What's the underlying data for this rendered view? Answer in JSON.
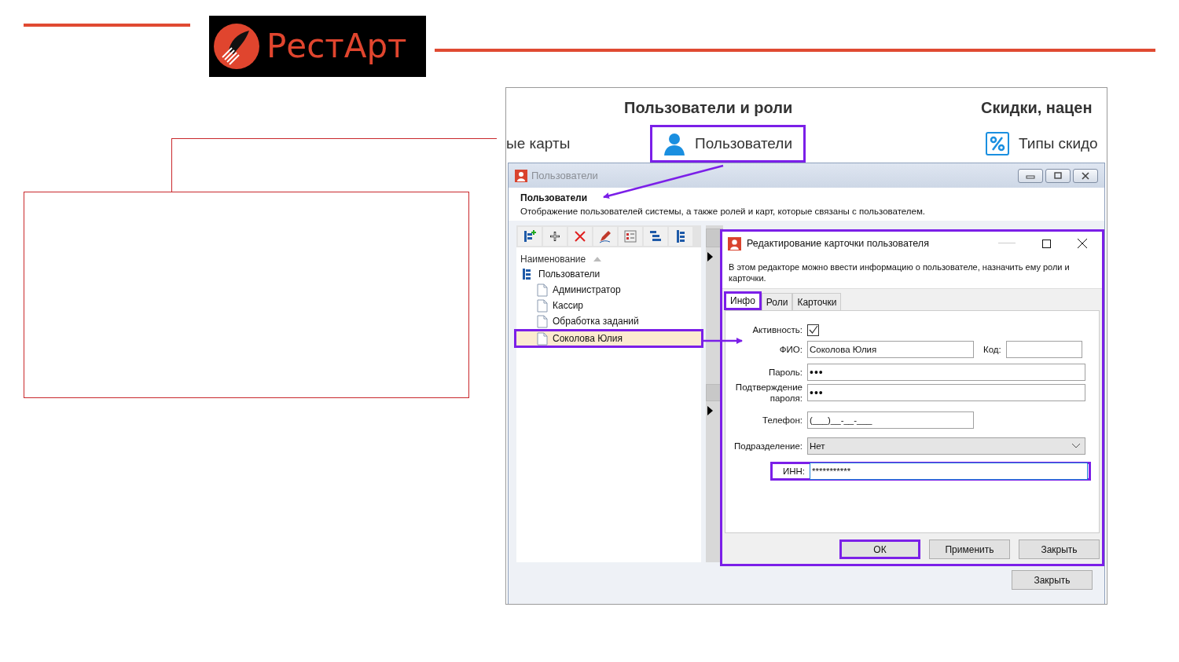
{
  "slide": {
    "logo": {
      "text": "РестАрт"
    }
  },
  "screenshot": {
    "ribbon": {
      "groups": [
        {
          "title": "Пользователи и роли"
        },
        {
          "title": "Скидки, нацен"
        }
      ],
      "items": [
        {
          "label": "ые карты",
          "kind": "text",
          "highlighted": false
        },
        {
          "label": "Пользователи",
          "kind": "user",
          "highlighted": true
        },
        {
          "label": "Типы скидо",
          "kind": "percent",
          "highlighted": false
        }
      ]
    },
    "users_window": {
      "title": "Пользователи",
      "heading": "Пользователи",
      "description": "Отображение пользователей системы, а также ролей и карт, которые связаны с пользователем.",
      "tree": {
        "column": "Наименование",
        "root": {
          "label": "Пользователи",
          "children": [
            {
              "label": "Администратор",
              "selected": false,
              "highlighted": false
            },
            {
              "label": "Кассир",
              "selected": false,
              "highlighted": false
            },
            {
              "label": "Обработка заданий",
              "selected": false,
              "highlighted": false
            },
            {
              "label": "Соколова Юлия",
              "selected": true,
              "highlighted": true
            }
          ]
        }
      },
      "close_button": "Закрыть"
    },
    "editor": {
      "title": "Редактирование карточки пользователя",
      "highlighted": true,
      "description": "В этом редакторе можно ввести информацию о пользователе, назначить ему роли и карточки.",
      "tabs": [
        {
          "label": "Инфо",
          "selected": true,
          "highlighted": true
        },
        {
          "label": "Роли",
          "selected": false,
          "highlighted": false
        },
        {
          "label": "Карточки",
          "selected": false,
          "highlighted": false
        }
      ],
      "fields": [
        {
          "kind": "checkbox",
          "label": "Активность:",
          "checked": true,
          "highlighted": false
        },
        {
          "kind": "text",
          "label": "ФИО:",
          "value": "Соколова Юлия",
          "extra": {
            "label": "Код:"
          },
          "highlighted": false
        },
        {
          "kind": "password",
          "label": "Пароль:",
          "value": "•••",
          "highlighted": false
        },
        {
          "kind": "password",
          "label": "Подтверждение пароля:",
          "value": "•••",
          "highlighted": false
        },
        {
          "kind": "masked",
          "label": "Телефон:",
          "value": "(___)__-__-___",
          "highlighted": false
        },
        {
          "kind": "select",
          "label": "Подразделение:",
          "value": "Нет",
          "highlighted": false
        },
        {
          "kind": "text",
          "label": "ИНН:",
          "value": "***********",
          "highlighted": true
        }
      ],
      "buttons": [
        {
          "label": "ОК",
          "highlighted": true
        },
        {
          "label": "Применить",
          "highlighted": false
        },
        {
          "label": "Закрыть",
          "highlighted": false
        }
      ]
    }
  }
}
